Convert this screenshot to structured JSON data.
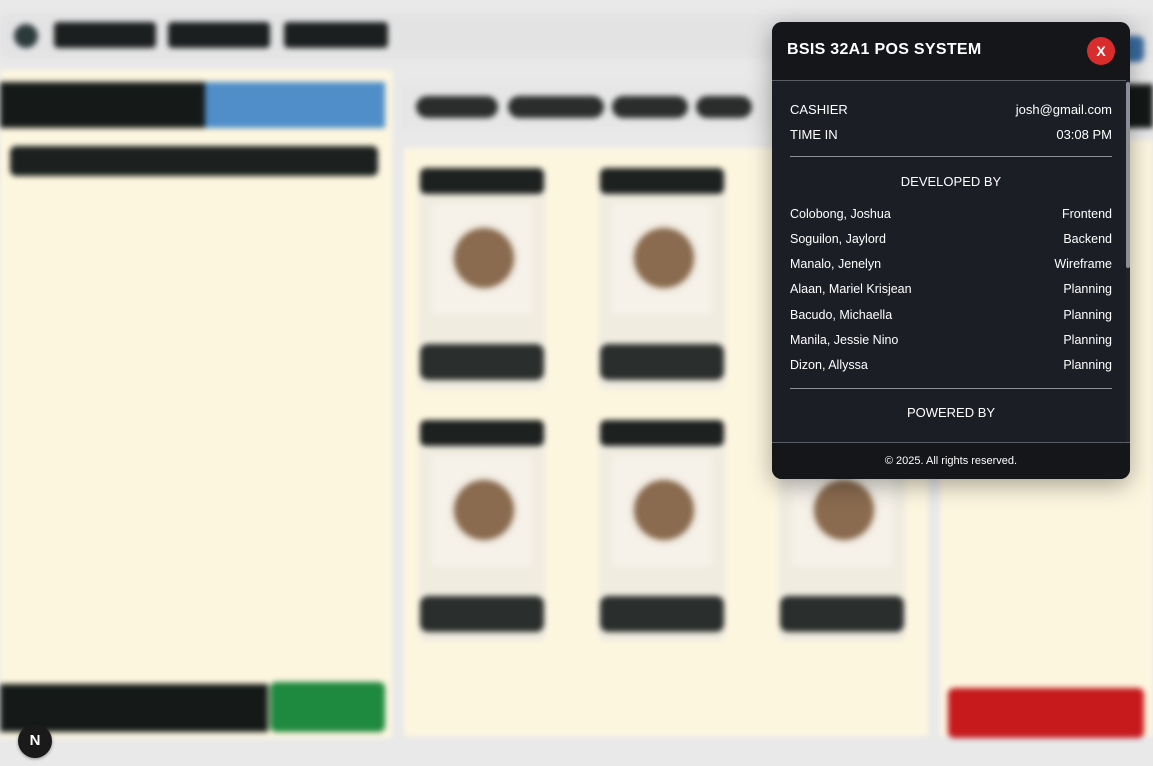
{
  "modal": {
    "title": "BSIS 32A1 POS SYSTEM",
    "close_label": "X",
    "cashier_label": "CASHIER",
    "cashier_value": "josh@gmail.com",
    "time_in_label": "TIME IN",
    "time_in_value": "03:08 PM",
    "developed_by_label": "DEVELOPED BY",
    "developers": [
      {
        "name": "Colobong, Joshua",
        "role": "Frontend"
      },
      {
        "name": "Soguilon, Jaylord",
        "role": "Backend"
      },
      {
        "name": "Manalo, Jenelyn",
        "role": "Wireframe"
      },
      {
        "name": "Alaan, Mariel Krisjean",
        "role": "Planning"
      },
      {
        "name": "Bacudo, Michaella",
        "role": "Planning"
      },
      {
        "name": "Manila, Jessie Nino",
        "role": "Planning"
      },
      {
        "name": "Dizon, Allyssa",
        "role": "Planning"
      }
    ],
    "powered_by_label": "POWERED BY",
    "copyright": "© 2025. All rights reserved."
  },
  "badge": {
    "letter": "N"
  },
  "colors": {
    "modal_bg": "#1b1e25",
    "close_button": "#d92d2d",
    "accent_blue": "#4f8ec8",
    "pay_green": "#1e8a3f",
    "clear_red": "#c61a1d",
    "panel_cream": "#fdf6df"
  }
}
